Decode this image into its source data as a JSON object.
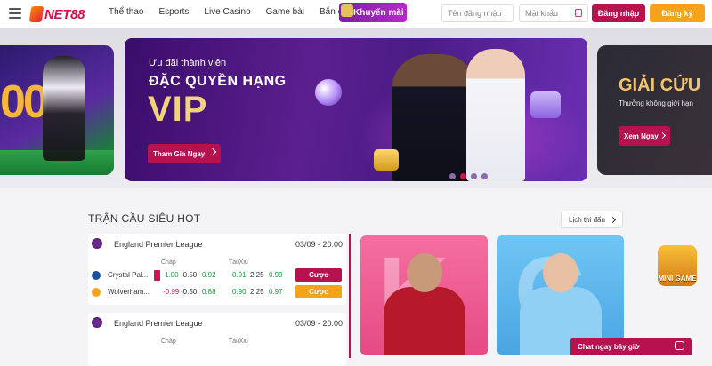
{
  "brand": {
    "logo_text": "NET88",
    "accent": "#b5124e",
    "secondary": "#f4a31b"
  },
  "nav": {
    "items": [
      "Thể thao",
      "Esports",
      "Live Casino",
      "Game bài",
      "Bắn cá"
    ],
    "promo_label": "Khuyến mãi"
  },
  "auth": {
    "username_placeholder": "Tên đăng nhập",
    "password_placeholder": "Mật khẩu",
    "login_label": "Đăng nhập",
    "register_label": "Đăng ký"
  },
  "banner": {
    "kicker": "Ưu đãi thành viên",
    "title_line1": "ĐẶC QUYỀN HẠNG",
    "title_line2": "VIP",
    "cta_label": "Tham Gia Ngay",
    "right_title": "GIẢI CỨU",
    "right_subtitle": "Thưởng không giới hạn",
    "right_cta_label": "Xem Ngay",
    "active_slide": 2,
    "slide_count": 4
  },
  "matches": {
    "section_title": "TRẬN CẦU SIÊU HOT",
    "schedule_label": "Lịch thi đấu",
    "handicap_header": "Chấp",
    "ou_header": "Tài/Xỉu",
    "bet_label": "Cược",
    "list": [
      {
        "league": "England Premier League",
        "time": "03/09 - 20:00",
        "home": {
          "name": "Crystal Pal...",
          "h1": "1.00",
          "h2": "-0.50",
          "h3": "0.92",
          "o1": "0.91",
          "o2": "2.25",
          "o3": "0.99"
        },
        "away": {
          "name": "Wolverham...",
          "h1": "-0.99",
          "h2": "-0.50",
          "h3": "0.88",
          "o1": "0.90",
          "o2": "2.25",
          "o3": "0.97"
        }
      },
      {
        "league": "England Premier League",
        "time": "03/09 - 20:00"
      }
    ]
  },
  "mini_game_label": "MINI GAME",
  "chat_label": "Chat ngay bây giờ"
}
